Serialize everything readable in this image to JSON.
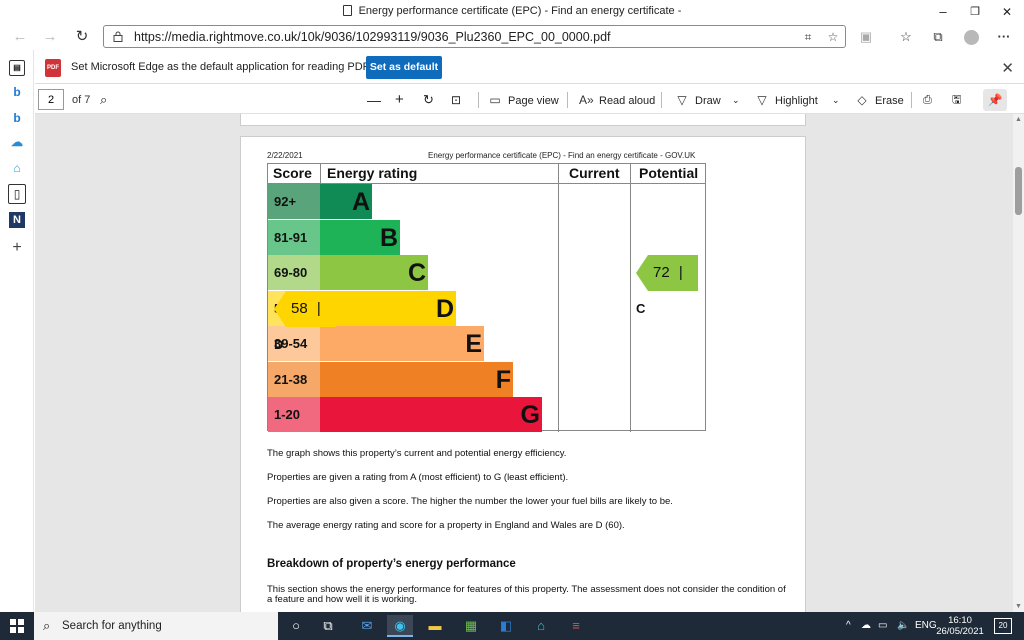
{
  "window": {
    "title": "Energy performance certificate (EPC) - Find an energy certificate -",
    "minimize": "–",
    "restore": "❐",
    "close": "✕"
  },
  "address": {
    "url": "https://media.rightmove.co.uk/10k/9036/102993119/9036_Plu2360_EPC_00_0000.pdf"
  },
  "notification": {
    "badge": "PDF",
    "text": "Set Microsoft Edge as the default application for reading PDF files?",
    "button": "Set as default"
  },
  "pdf_toolbar": {
    "page_number": "2",
    "page_of": "of 7",
    "page_view": "Page view",
    "read_aloud": "Read aloud",
    "draw": "Draw",
    "highlight": "Highlight",
    "erase": "Erase"
  },
  "document": {
    "date": "2/22/2021",
    "header_title": "Energy performance certificate (EPC) - Find an energy certificate - GOV.UK",
    "table_headers": {
      "score": "Score",
      "rating": "Energy rating",
      "current": "Current",
      "potential": "Potential"
    },
    "bands": [
      {
        "score": "92+",
        "letter": "A",
        "color": "#108b55",
        "score_bg": "#5aa47c",
        "frac": 0.225
      },
      {
        "score": "81-91",
        "letter": "B",
        "color": "#1fb357",
        "score_bg": "#69c68a",
        "frac": 0.345
      },
      {
        "score": "69-80",
        "letter": "C",
        "color": "#8dc642",
        "score_bg": "#b2d98a",
        "frac": 0.465
      },
      {
        "score": "55-68",
        "letter": "D",
        "color": "#ffd500",
        "score_bg": "#ffe35c",
        "frac": 0.585
      },
      {
        "score": "39-54",
        "letter": "E",
        "color": "#fcaa65",
        "score_bg": "#fdc99b",
        "frac": 0.705
      },
      {
        "score": "21-38",
        "letter": "F",
        "color": "#ef8023",
        "score_bg": "#f5a868",
        "frac": 0.83
      },
      {
        "score": "1-20",
        "letter": "G",
        "color": "#e9153b",
        "score_bg": "#f0697f",
        "frac": 0.955
      }
    ],
    "current": {
      "score": "58",
      "sep": "|",
      "letter": "D",
      "band_index": 3,
      "color": "#ffd500"
    },
    "potential": {
      "score": "72",
      "sep": "|",
      "letter": "C",
      "band_index": 2,
      "color": "#8dc642"
    },
    "paragraphs": [
      "The graph shows this property’s current and potential energy efficiency.",
      "Properties are given a rating from A (most efficient) to G (least efficient).",
      "Properties are also given a score. The higher the number the lower your fuel bills are likely to be.",
      "The average energy rating and score for a property in England and Wales are D (60)."
    ],
    "section_heading": "Breakdown of property’s energy performance",
    "section_text_1": "This section shows the energy performance for features of this property. The assessment does not consider the condition of",
    "section_text_2": "a feature and how well it is working."
  },
  "taskbar": {
    "search_placeholder": "Search for anything",
    "lang": "ENG",
    "time": "16:10",
    "date": "26/05/2021",
    "notifications": "20"
  }
}
